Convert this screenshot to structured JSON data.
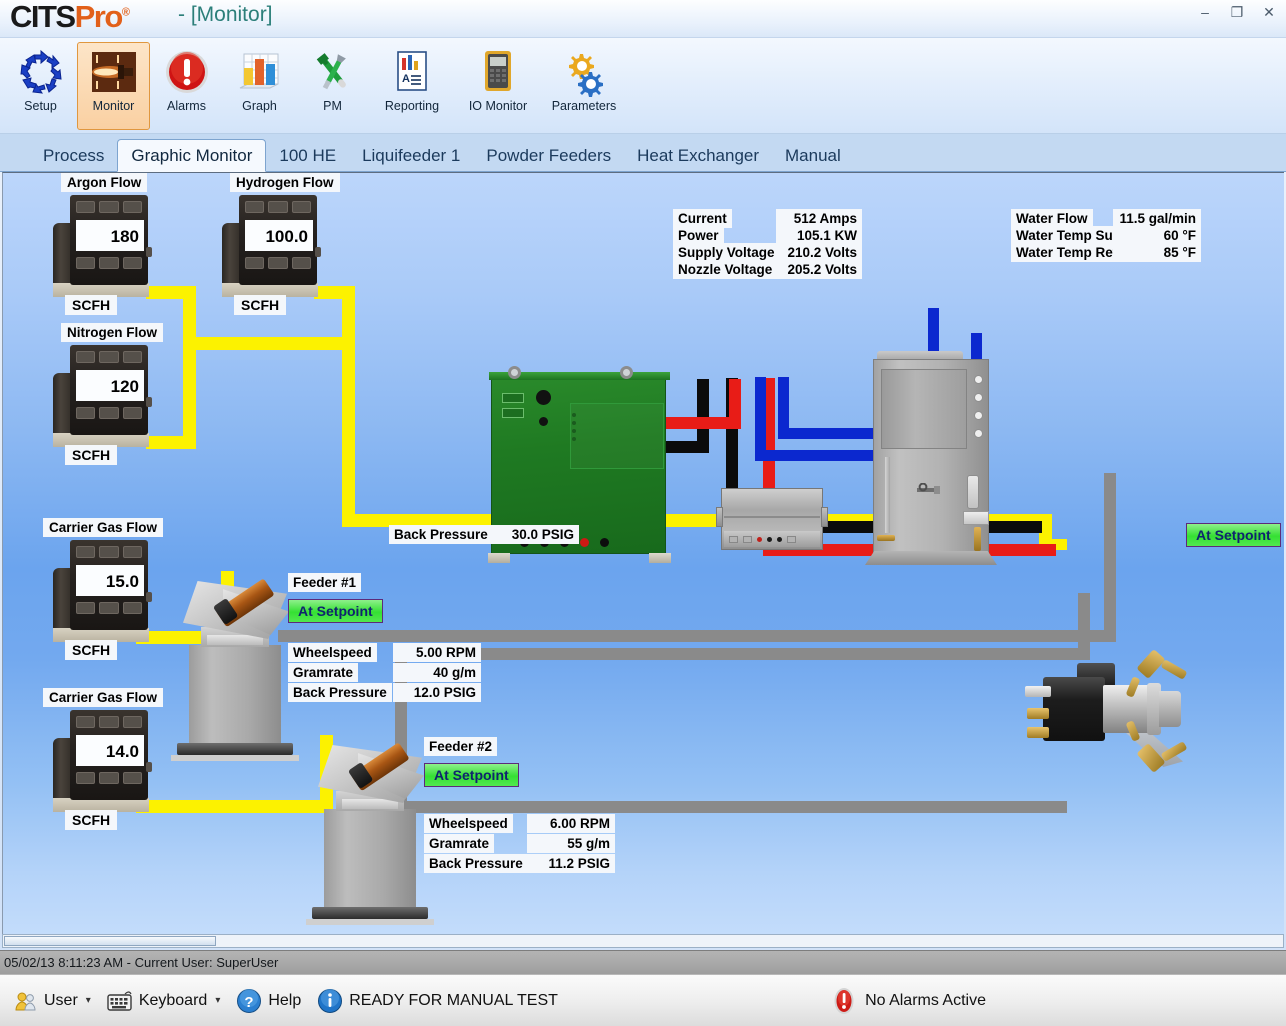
{
  "window": {
    "brand_cits": "CITS",
    "brand_pro": "Pro",
    "brand_reg": "®",
    "title": "- [Monitor]",
    "minimize": "–",
    "maximize": "❐",
    "close": "✕"
  },
  "toolbar": {
    "items": [
      {
        "label": "Setup",
        "icon": "recycle-arrows-icon",
        "selected": false
      },
      {
        "label": "Monitor",
        "icon": "plasma-flame-icon",
        "selected": true
      },
      {
        "label": "Alarms",
        "icon": "red-alert-icon",
        "selected": false
      },
      {
        "label": "Graph",
        "icon": "bar-chart-icon",
        "selected": false
      },
      {
        "label": "PM",
        "icon": "wrench-tools-icon",
        "selected": false
      },
      {
        "label": "Reporting",
        "icon": "report-document-icon",
        "selected": false
      },
      {
        "label": "IO Monitor",
        "icon": "multimeter-icon",
        "selected": false
      },
      {
        "label": "Parameters",
        "icon": "gears-icon",
        "selected": false
      }
    ]
  },
  "tabs": [
    {
      "label": "Process",
      "selected": false
    },
    {
      "label": "Graphic Monitor",
      "selected": true
    },
    {
      "label": "100 HE",
      "selected": false
    },
    {
      "label": "Liquifeeder 1",
      "selected": false
    },
    {
      "label": "Powder Feeders",
      "selected": false
    },
    {
      "label": "Heat Exchanger",
      "selected": false
    },
    {
      "label": "Manual",
      "selected": false
    }
  ],
  "gas_meters": [
    {
      "caption": "Argon Flow",
      "value": "180",
      "unit": "SCFH"
    },
    {
      "caption": "Hydrogen Flow",
      "value": "100.0",
      "unit": "SCFH"
    },
    {
      "caption": "Nitrogen Flow",
      "value": "120",
      "unit": "SCFH"
    },
    {
      "caption": "Carrier Gas Flow",
      "value": "15.0",
      "unit": "SCFH"
    },
    {
      "caption": "Carrier Gas Flow",
      "value": "14.0",
      "unit": "SCFH"
    }
  ],
  "electrical": {
    "rows": [
      {
        "label": "Current",
        "value": "512 Amps"
      },
      {
        "label": "Power",
        "value": "105.1 KW"
      },
      {
        "label": "Supply Voltage",
        "value": "210.2 Volts"
      },
      {
        "label": "Nozzle Voltage",
        "value": "205.2 Volts"
      }
    ]
  },
  "water": {
    "rows": [
      {
        "label": "Water Flow",
        "value": "11.5 gal/min"
      },
      {
        "label": "Water Temp Supply",
        "value": "60 °F"
      },
      {
        "label": "Water Temp Return",
        "value": "85 °F"
      }
    ]
  },
  "gun_back_pressure": {
    "label": "Back Pressure",
    "value": "30.0 PSIG"
  },
  "gun_status": "At Setpoint",
  "feeders": [
    {
      "title": "Feeder #1",
      "status": "At Setpoint",
      "rows": [
        {
          "label": "Wheelspeed",
          "value": "5.00 RPM"
        },
        {
          "label": "Gramrate",
          "value": "40 g/m"
        },
        {
          "label": "Back Pressure",
          "value": "12.0 PSIG"
        }
      ]
    },
    {
      "title": "Feeder #2",
      "status": "At Setpoint",
      "rows": [
        {
          "label": "Wheelspeed",
          "value": "6.00 RPM"
        },
        {
          "label": "Gramrate",
          "value": "55 g/m"
        },
        {
          "label": "Back Pressure",
          "value": "11.2 PSIG"
        }
      ]
    }
  ],
  "userbar": {
    "text": "05/02/13 8:11:23 AM - Current User:  SuperUser"
  },
  "statusbar": {
    "user_label": "User",
    "keyboard_label": "Keyboard",
    "help_label": "Help",
    "ready_text": "READY FOR MANUAL TEST",
    "alarm_text": "No Alarms Active",
    "caret": "▾"
  },
  "colors": {
    "accent_orange": "#e2601a",
    "title_teal": "#2c7f7a",
    "setpoint_green": "#35e033",
    "pipe_yellow": "#fcf200",
    "pipe_red": "#e81c17",
    "pipe_blue": "#0b28cf",
    "pipe_black": "#0b0b0b",
    "pipe_grey": "#8a8a8a",
    "psu_green": "#1f7a22"
  }
}
